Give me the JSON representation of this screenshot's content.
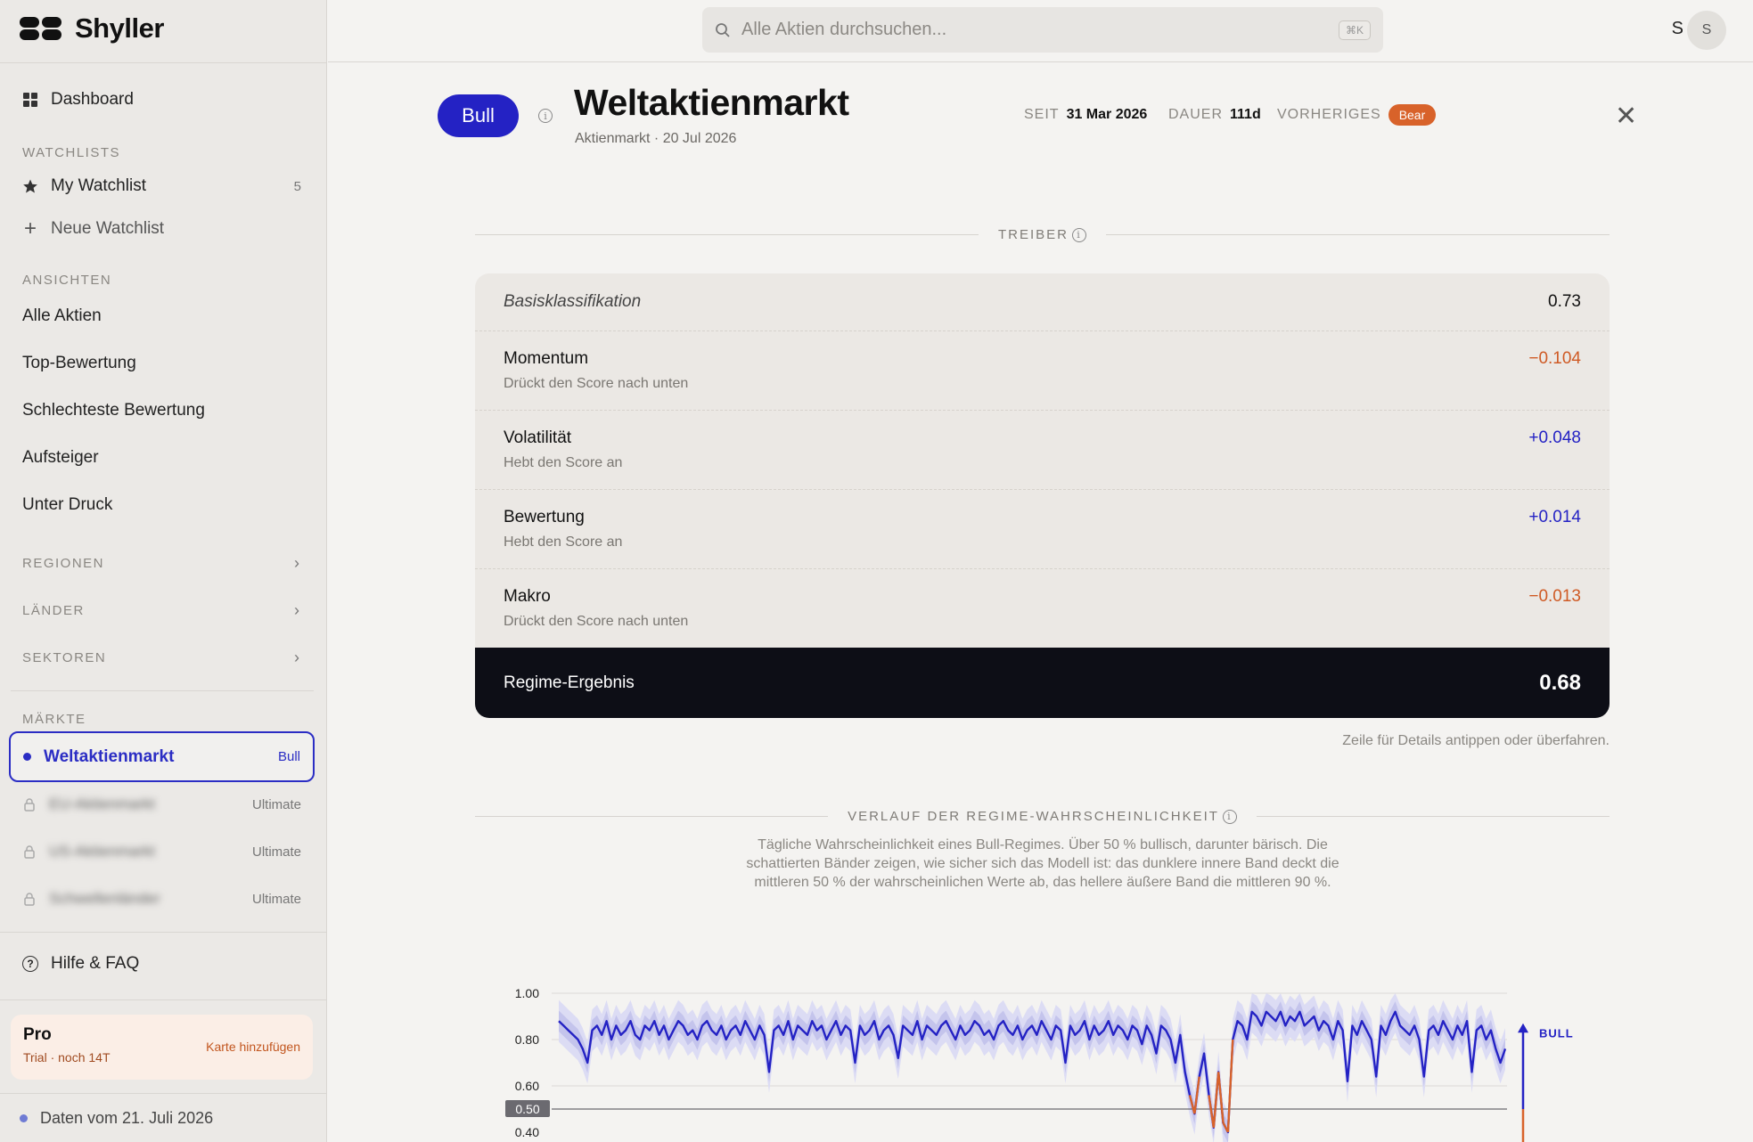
{
  "app": {
    "name": "Shyller"
  },
  "sidebar": {
    "dashboard_label": "Dashboard",
    "watchlists_heading": "WATCHLISTS",
    "my_watchlist": {
      "label": "My Watchlist",
      "count": "5"
    },
    "new_watchlist_label": "Neue Watchlist",
    "views_heading": "ANSICHTEN",
    "views": [
      "Alle Aktien",
      "Top-Bewertung",
      "Schlechteste Bewertung",
      "Aufsteiger",
      "Unter Druck"
    ],
    "groups": [
      "REGIONEN",
      "LÄNDER",
      "SEKTOREN"
    ],
    "markets_heading": "MÄRKTE",
    "active_market": {
      "label": "Weltaktienmarkt",
      "tag": "Bull"
    },
    "locked_markets": [
      {
        "label": "EU-Aktienmarkt",
        "tag": "Ultimate"
      },
      {
        "label": "US-Aktienmarkt",
        "tag": "Ultimate"
      },
      {
        "label": "Schwellenländer",
        "tag": "Ultimate"
      }
    ],
    "help_label": "Hilfe & FAQ",
    "pro": {
      "title": "Pro",
      "subtitle": "Trial · noch 14T",
      "link": "Karte hinzufügen"
    },
    "data_date": "Daten vom 21. Juli 2026"
  },
  "topbar": {
    "search_placeholder": "Alle Aktien durchsuchen...",
    "shortcut": "⌘K",
    "user_letter": "S",
    "avatar_letter": "S"
  },
  "header": {
    "regime_badge": "Bull",
    "title": "Weltaktienmarkt",
    "subtitle": "Aktienmarkt · 20 Jul 2026",
    "since_label": "SEIT",
    "since_value": "31 Mar 2026",
    "duration_label": "DAUER",
    "duration_value": "111d",
    "previous_label": "VORHERIGES",
    "previous_value": "Bear"
  },
  "drivers": {
    "heading": "TREIBER",
    "base": {
      "label": "Basisklassifikation",
      "value": "0.73"
    },
    "rows": [
      {
        "label": "Momentum",
        "sub": "Drückt den Score nach unten",
        "value": "−0.104",
        "sign": "neg"
      },
      {
        "label": "Volatilität",
        "sub": "Hebt den Score an",
        "value": "+0.048",
        "sign": "pos"
      },
      {
        "label": "Bewertung",
        "sub": "Hebt den Score an",
        "value": "+0.014",
        "sign": "pos"
      },
      {
        "label": "Makro",
        "sub": "Drückt den Score nach unten",
        "value": "−0.013",
        "sign": "neg"
      }
    ],
    "result": {
      "label": "Regime-Ergebnis",
      "value": "0.68"
    },
    "hint": "Zeile für Details antippen oder überfahren."
  },
  "history": {
    "heading": "VERLAUF DER REGIME-WAHRSCHEINLICHKEIT",
    "description": "Tägliche Wahrscheinlichkeit eines Bull-Regimes. Über 50 % bullisch, darunter bärisch. Die schattierten Bänder zeigen, wie sicher sich das Modell ist: das dunklere innere Band deckt die mittleren 50 % der wahrscheinlichen Werte ab, das hellere äußere Band die mittleren 90 %."
  },
  "colors": {
    "accent": "#2422c4",
    "bear": "#d8622a",
    "dark": "#0d0e16"
  },
  "chart_data": {
    "type": "line",
    "y_ticks": [
      "1.00",
      "0.80",
      "0.60",
      "0.50",
      "0.40"
    ],
    "ylim": [
      0.4,
      1.0
    ],
    "threshold": 0.5,
    "bull_label": "BULL",
    "series": [
      {
        "values": [
          0.88,
          0.86,
          0.84,
          0.82,
          0.8,
          0.76,
          0.7,
          0.84,
          0.86,
          0.82,
          0.88,
          0.8,
          0.86,
          0.82,
          0.84,
          0.88,
          0.82,
          0.8,
          0.86,
          0.84,
          0.88,
          0.82,
          0.86,
          0.8,
          0.84,
          0.88,
          0.86,
          0.82,
          0.84,
          0.8,
          0.86,
          0.88,
          0.84,
          0.82,
          0.86,
          0.8,
          0.84,
          0.86,
          0.82,
          0.88,
          0.84,
          0.8,
          0.86,
          0.82,
          0.66,
          0.84,
          0.86,
          0.82,
          0.88,
          0.8,
          0.86,
          0.84,
          0.82,
          0.88,
          0.84,
          0.86,
          0.8,
          0.84,
          0.88,
          0.82,
          0.86,
          0.84,
          0.7,
          0.86,
          0.82,
          0.84,
          0.88,
          0.8,
          0.84,
          0.86,
          0.82,
          0.72,
          0.86,
          0.84,
          0.82,
          0.88,
          0.8,
          0.86,
          0.84,
          0.82,
          0.86,
          0.88,
          0.84,
          0.8,
          0.86,
          0.82,
          0.84,
          0.88,
          0.86,
          0.82,
          0.84,
          0.8,
          0.86,
          0.88,
          0.84,
          0.82,
          0.86,
          0.8,
          0.84,
          0.86,
          0.82,
          0.88,
          0.84,
          0.8,
          0.86,
          0.84,
          0.7,
          0.86,
          0.82,
          0.84,
          0.88,
          0.8,
          0.86,
          0.82,
          0.84,
          0.88,
          0.82,
          0.86,
          0.84,
          0.8,
          0.86,
          0.84,
          0.78,
          0.86,
          0.82,
          0.74,
          0.86,
          0.84,
          0.8,
          0.7,
          0.82,
          0.66,
          0.56,
          0.48,
          0.64,
          0.74,
          0.56,
          0.42,
          0.66,
          0.44,
          0.4,
          0.8,
          0.88,
          0.86,
          0.8,
          0.92,
          0.9,
          0.86,
          0.92,
          0.9,
          0.88,
          0.92,
          0.86,
          0.9,
          0.88,
          0.92,
          0.86,
          0.88,
          0.9,
          0.84,
          0.88,
          0.86,
          0.8,
          0.88,
          0.84,
          0.62,
          0.86,
          0.82,
          0.88,
          0.84,
          0.8,
          0.64,
          0.86,
          0.82,
          0.88,
          0.92,
          0.86,
          0.84,
          0.82,
          0.86,
          0.8,
          0.64,
          0.84,
          0.86,
          0.82,
          0.88,
          0.84,
          0.8,
          0.86,
          0.82,
          0.88,
          0.66,
          0.84,
          0.86,
          0.8,
          0.84,
          0.76,
          0.7,
          0.76
        ]
      }
    ]
  }
}
